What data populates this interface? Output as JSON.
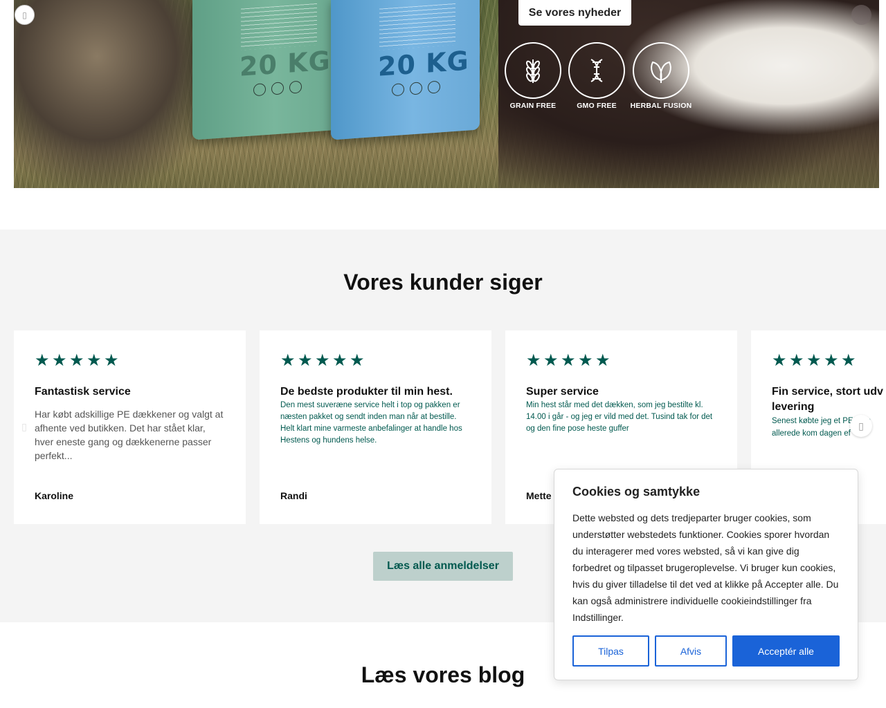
{
  "hero": {
    "news_button": "Se vores nyheder",
    "bag_weight": "20 KG",
    "badges": [
      {
        "label": "GRAIN FREE",
        "icon": "wheat-icon"
      },
      {
        "label": "GMO FREE",
        "icon": "dna-icon"
      },
      {
        "label": "HERBAL FUSION",
        "icon": "leaves-icon"
      }
    ]
  },
  "reviews": {
    "heading": "Vores kunder siger",
    "rating_stars": 5,
    "star_color": "#00594f",
    "items": [
      {
        "title": "Fantastisk service",
        "body": "Har købt adskillige PE dækkener og valgt at afhente ved butikken. Det har stået klar, hver eneste gang og dækkenerne passer perfekt...",
        "author": "Karoline"
      },
      {
        "title": "De bedste produkter til min hest.",
        "body": "Den mest suveræne service helt i top og pakken er næsten pakket og sendt inden man når at bestille. Helt klart mine varmeste anbefalinger at handle hos Hestens og hundens helse.",
        "author": "Randi"
      },
      {
        "title": "Super service",
        "body": "Min hest står med det dækken, som jeg bestilte kl. 14.00 i går - og jeg er vild med det. Tusind tak for det og den fine pose heste guffer",
        "author": "Mette"
      },
      {
        "title": "Fin service, stort udv levering",
        "body": "Senest købte jeg et PE tegn allerede kom dagen ef",
        "author": ""
      }
    ],
    "all_reviews_button": "Læs alle anmeldelser"
  },
  "blog": {
    "heading": "Læs vores blog"
  },
  "cookie": {
    "title": "Cookies og samtykke",
    "text": "Dette websted og dets tredjeparter bruger cookies, som understøtter webstedets funktioner. Cookies sporer hvordan du interagerer med vores websted, så vi kan give dig forbedret og tilpasset brugeroplevelse. Vi bruger kun cookies, hvis du giver tilladelse til det ved at klikke på Accepter alle. Du kan også administrere individuelle cookieindstillinger fra Indstillinger.",
    "customize_label": "Tilpas",
    "reject_label": "Afvis",
    "accept_label": "Acceptér alle",
    "accent_color": "#1a63d8"
  }
}
